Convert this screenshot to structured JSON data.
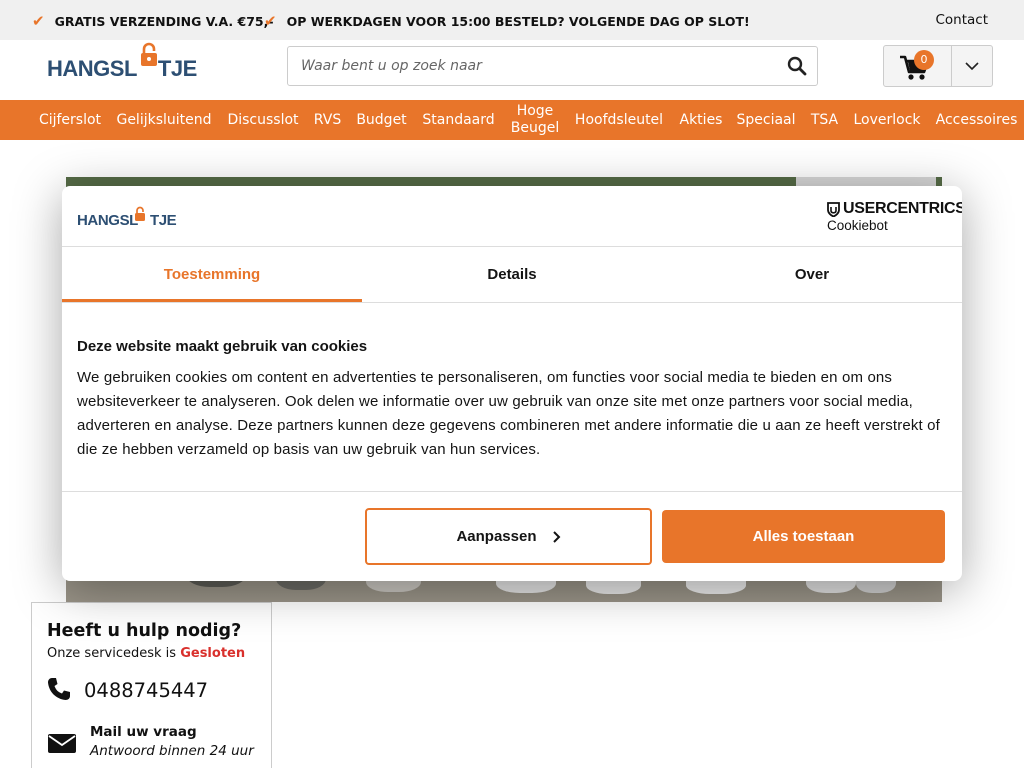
{
  "topbar": {
    "usp": [
      "GRATIS VERZENDING V.A. €75,-",
      "OP WERKDAGEN VOOR 15:00 BESTELD? VOLGENDE DAG OP SLOT!"
    ],
    "contact": "Contact"
  },
  "header": {
    "logo_text_before": "HANGSL",
    "logo_text_after": "TJE",
    "search_placeholder": "Waar bent u op zoek naar",
    "cart_count": "0"
  },
  "nav": {
    "items": [
      "Cijferslot",
      "Gelijksluitend",
      "Discusslot",
      "RVS",
      "Budget",
      "Standaard",
      "Hoge Beugel",
      "Hoofdsleutel",
      "Akties",
      "Speciaal",
      "TSA",
      "Loverlock",
      "Accessoires"
    ]
  },
  "help": {
    "title": "Heeft u hulp nodig?",
    "service_prefix": "Onze servicedesk is",
    "service_status": "Gesloten",
    "phone": "0488745447",
    "mail_title": "Mail uw vraag",
    "mail_sub": "Antwoord binnen 24 uur"
  },
  "cookie": {
    "logo_text_before": "HANGSL",
    "logo_text_after": "TJE",
    "brand_top": "USERCENTRICS",
    "brand_bottom": "Cookiebot",
    "tabs": [
      "Toestemming",
      "Details",
      "Over"
    ],
    "title": "Deze website maakt gebruik van cookies",
    "body": "We gebruiken cookies om content en advertenties te personaliseren, om functies voor social media te bieden en om ons websiteverkeer te analyseren. Ook delen we informatie over uw gebruik van onze site met onze partners voor social media, adverteren en analyse. Deze partners kunnen deze gegevens combineren met andere informatie die u aan ze heeft verstrekt of die ze hebben verzameld op basis van uw gebruik van hun services.",
    "btn_customize": "Aanpassen",
    "btn_allow_all": "Alles toestaan"
  },
  "colors": {
    "accent": "#e8752a",
    "brand_blue": "#2d4f73",
    "closed_red": "#d9302c"
  },
  "icons": [
    "check-icon",
    "padlock-icon",
    "search-icon",
    "cart-icon",
    "chevron-down-icon",
    "phone-icon",
    "mail-icon",
    "shield-icon",
    "chevron-right-icon"
  ]
}
